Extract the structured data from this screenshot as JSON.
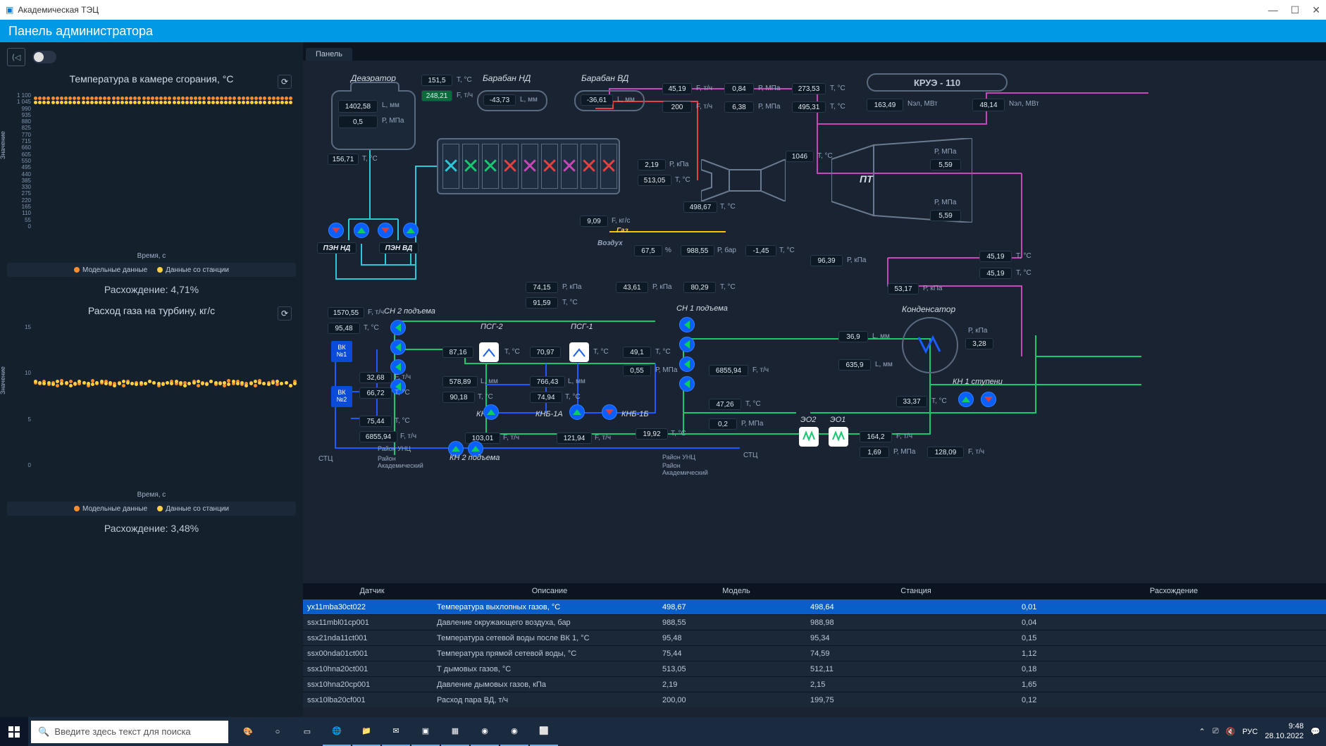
{
  "window": {
    "title": "Академическая ТЭЦ"
  },
  "header": {
    "title": "Панель администратора"
  },
  "rp": {
    "tab": "Панель"
  },
  "chart1": {
    "title": "Температура в камере сгорания, °C",
    "ylabel": "Значение",
    "xlabel": "Время, с",
    "yTicks": [
      "1 100",
      "1 045",
      "990",
      "935",
      "880",
      "825",
      "770",
      "715",
      "660",
      "605",
      "550",
      "495",
      "440",
      "385",
      "330",
      "275",
      "220",
      "165",
      "110",
      "55",
      "0"
    ],
    "legend1": "Модельные данные",
    "legend2": "Данные со станции",
    "divergence": "Расхождение: 4,71%"
  },
  "chart2": {
    "title": "Расход газа на турбину, кг/с",
    "ylabel": "Значение",
    "xlabel": "Время, с",
    "yTicks": [
      "15",
      "10",
      "5",
      "0"
    ],
    "legend1": "Модельные данные",
    "legend2": "Данные со станции",
    "divergence": "Расхождение: 3,48%"
  },
  "mimic": {
    "deaerator": {
      "label": "Деаэратор",
      "L": "1402,58",
      "Lunit": "L, мм",
      "P": "0,5",
      "Punit": "Р, МПа",
      "T1": "151,5",
      "T2": "248,21",
      "T3": "156,71"
    },
    "baraban_nd": {
      "label": "Барабан НД",
      "L": "-43,73",
      "Lunit": "L, мм"
    },
    "baraban_vd": {
      "label": "Барабан ВД",
      "L": "-36,61",
      "Lunit": "L, мм"
    },
    "krue": {
      "label": "КРУЭ - 110",
      "N1": "163,49",
      "N1u": "Nэл, МВт",
      "N2": "48,14",
      "N2u": "Nэл, МВт"
    },
    "row1": {
      "v1": "45,19",
      "u1": "F, т/ч",
      "v2": "0,84",
      "u2": "Р, МПа",
      "v3": "273,53",
      "u3": "T, °C"
    },
    "row2": {
      "v1": "200",
      "u1": "F, т/ч",
      "v2": "6,38",
      "u2": "Р, МПа",
      "v3": "495,31",
      "u3": "T, °C"
    },
    "pen_nd": "ПЭН НД",
    "pen_vd": "ПЭН ВД",
    "gtu": {
      "T": "1046",
      "Tu": "T, °C",
      "Pk": "2,19",
      "Pku": "Р, кПа",
      "Tc": "513,05",
      "Tcu": "T, °C",
      "Te": "498,67",
      "Teu": "T, °C",
      "Fg": "9,09",
      "Fgu": "F, кг/с",
      "gas": "Газ",
      "air": "Воздух",
      "pct": "67,5",
      "pctu": "%",
      "Pb": "988,55",
      "Pbu": "Р, бар",
      "Ta": "-1,45",
      "Tau": "T, °C"
    },
    "pt": {
      "label": "ПТ",
      "P1": "5,59",
      "P1u": "Р, МПа",
      "P2": "5,59",
      "P2u": "Р, МПа"
    },
    "pk1": {
      "v": "96,39",
      "u": "Р, кПа"
    },
    "pk2": {
      "v": "53,17",
      "u": "Р, кПа"
    },
    "tr": {
      "v1": "45,19",
      "v2": "45,19",
      "u": "T, °C"
    },
    "cond": {
      "label": "Конденсатор",
      "L1": "36,9",
      "L2": "635,9",
      "Lu": "L, мм",
      "P": "3,28",
      "Pu": "Р, кПа"
    },
    "kn1s": {
      "label": "КН 1 ступени",
      "T": "33,37",
      "Tu": "T, °C"
    },
    "eo": {
      "e2": "ЭО2",
      "e1": "ЭО1",
      "F": "164,2",
      "Fu": "F, т/ч",
      "P": "1,69",
      "Pu": "Р, МПа",
      "F2": "128,09",
      "F2u": "F, т/ч"
    },
    "psg2": {
      "label": "ПСГ-2",
      "T": "87,16",
      "Tu": "T, °C",
      "L": "578,89",
      "Lu": "L, мм",
      "Td": "90,18",
      "Tdu": "T, °C"
    },
    "psg1": {
      "label": "ПСГ-1",
      "T": "70,97",
      "Tu": "T, °C",
      "L": "766,43",
      "Lu": "L, мм",
      "Td": "74,94",
      "Tdu": "T, °C"
    },
    "cn2": {
      "label": "СН 2 подъема",
      "F": "1570,55",
      "Fu": "F, т/ч",
      "T": "95,48",
      "Tu": "T, °C"
    },
    "cn1": {
      "label": "СН 1 подъема",
      "T": "49,1",
      "Tu": "T, °C",
      "P": "0,55",
      "Pu": "Р, МПа",
      "F": "6855,94",
      "Fu": "F, т/ч",
      "T2": "47,26",
      "T2u": "T, °C",
      "P2": "0,2",
      "P2u": "Р, МПа"
    },
    "vk1": {
      "label": "ВК\n№1",
      "F": "32,68",
      "Fu": "F, т/ч",
      "T": "66,72",
      "Tu": "T, °C"
    },
    "vk2": {
      "label": "ВК\n№2",
      "T": "75,44",
      "Tu": "T, °C",
      "F": "6855,94",
      "Fu": "F, т/ч"
    },
    "knb2": "КНБ-2",
    "knb1a": "КНБ-1А",
    "knb1b": "КНБ-1Б",
    "kn2p": "КН 2 подъема",
    "knb2F": {
      "v": "103,01",
      "u": "F, т/ч"
    },
    "knb1F": {
      "v": "121,94",
      "u": "F, т/ч"
    },
    "knbT": {
      "v": "19,92",
      "u": "T, °C"
    },
    "pk_mid": {
      "P": "74,15",
      "Pu": "Р, кПа",
      "T": "91,59",
      "Tu": "T, °C",
      "P2": "43,61",
      "P2u": "Р, кПа",
      "T2": "80,29",
      "T2u": "T, °C"
    },
    "stc": "СТЦ",
    "runc": "Район УНЦ",
    "rakad": "Район\nАкадемический"
  },
  "table": {
    "headers": [
      "Датчик",
      "Описание",
      "Модель",
      "Станция",
      "Расхождение"
    ],
    "rows": [
      {
        "c1": "yx11mba30ct022",
        "c2": "Температура выхлопных газов, °C",
        "c3": "498,67",
        "c4": "498,64",
        "c5": "0,01"
      },
      {
        "c1": "ssx11mbl01cp001",
        "c2": "Давление окружающего воздуха, бар",
        "c3": "988,55",
        "c4": "988,98",
        "c5": "0,04"
      },
      {
        "c1": "ssx21nda11ct001",
        "c2": "Температура сетевой воды после ВК 1, °C",
        "c3": "95,48",
        "c4": "95,34",
        "c5": "0,15"
      },
      {
        "c1": "ssx00nda01ct001",
        "c2": "Температура прямой сетевой воды, °C",
        "c3": "75,44",
        "c4": "74,59",
        "c5": "1,12"
      },
      {
        "c1": "ssx10hna20ct001",
        "c2": "Т дымовых газов, °C",
        "c3": "513,05",
        "c4": "512,11",
        "c5": "0,18"
      },
      {
        "c1": "ssx10hna20cp001",
        "c2": "Давление дымовых газов, кПа",
        "c3": "2,19",
        "c4": "2,15",
        "c5": "1,65"
      },
      {
        "c1": "ssx10lba20cf001",
        "c2": "Расход пара ВД, т/ч",
        "c3": "200,00",
        "c4": "199,75",
        "c5": "0,12"
      }
    ]
  },
  "taskbar": {
    "search": "Введите здесь текст для поиска",
    "lang": "РУС",
    "time": "9:48",
    "date": "28.10.2022"
  },
  "chart_data": [
    {
      "type": "scatter",
      "title": "Температура в камере сгорания, °C",
      "xlabel": "Время, с",
      "ylabel": "Значение",
      "ylim": [
        0,
        1100
      ],
      "series": [
        {
          "name": "Модельные данные",
          "values": [
            1045,
            1045,
            1045,
            1045,
            1045,
            1045,
            1045,
            1045,
            1045,
            1045,
            1045,
            1045,
            1045,
            1045,
            1045,
            1045,
            1045,
            1045,
            1045,
            1045,
            1045,
            1045,
            1045,
            1045,
            1045,
            1045,
            1045,
            1045,
            1045,
            1045,
            1045,
            1045,
            1045,
            1045,
            1045,
            1045,
            1045,
            1045,
            1045,
            1045,
            1045,
            1045,
            1045,
            1045,
            1045,
            1045,
            1045,
            1045,
            1045,
            1045,
            1045,
            1045,
            1045,
            1045,
            1045,
            1045,
            1045,
            1045,
            1045,
            1045
          ]
        },
        {
          "name": "Данные со станции",
          "values": [
            1060,
            1060,
            1060,
            1060,
            1060,
            1060,
            1060,
            1060,
            1060,
            1060,
            1060,
            1060,
            1060,
            1060,
            1060,
            1060,
            1060,
            1060,
            1060,
            1060,
            1060,
            1060,
            1060,
            1060,
            1060,
            1060,
            1060,
            1060,
            1060,
            1060,
            1060,
            1060,
            1060,
            1060,
            1060,
            1060,
            1060,
            1060,
            1060,
            1060,
            1060,
            1060,
            1060,
            1060,
            1060,
            1060,
            1060,
            1060,
            1060,
            1060,
            1060,
            1060,
            1060,
            1060,
            1060,
            1060,
            1060,
            1060,
            1060,
            1060
          ]
        }
      ]
    },
    {
      "type": "scatter",
      "title": "Расход газа на турбину, кг/с",
      "xlabel": "Время, с",
      "ylabel": "Значение",
      "ylim": [
        0,
        15
      ],
      "series": [
        {
          "name": "Модельные данные",
          "values": [
            9.1,
            9.0,
            9.2,
            8.9,
            9.1,
            8.8,
            9.3,
            9.0,
            9.2,
            8.9,
            9.0,
            9.1,
            8.8,
            9.3,
            9.0,
            9.1,
            9.2,
            8.9,
            9.0,
            9.1,
            8.8,
            9.2,
            9.0,
            9.1,
            8.9,
            9.0,
            9.2,
            9.1,
            8.8,
            9.0,
            9.1,
            9.2,
            9.0,
            8.9,
            9.1,
            9.0,
            9.2,
            8.8,
            9.1,
            9.0,
            9.2,
            8.9,
            9.1,
            8.8,
            9.3,
            9.0,
            9.2,
            8.9,
            9.0,
            9.1,
            8.8,
            9.3,
            9.0,
            9.1,
            9.2,
            8.9,
            9.0,
            9.1,
            8.8,
            9.2
          ]
        },
        {
          "name": "Данные со станции",
          "values": [
            9.2,
            9.1,
            9.0,
            9.1,
            8.9,
            9.2,
            9.0,
            9.1,
            8.8,
            9.0,
            9.2,
            9.1,
            9.0,
            8.9,
            9.1,
            9.2,
            9.0,
            9.1,
            8.8,
            9.0,
            9.2,
            9.1,
            9.0,
            8.9,
            9.1,
            9.0,
            9.2,
            9.1,
            9.0,
            8.9,
            9.1,
            9.0,
            9.2,
            9.1,
            8.8,
            9.0,
            9.1,
            9.2,
            9.0,
            8.9,
            9.2,
            9.1,
            9.0,
            9.1,
            8.9,
            9.2,
            9.0,
            9.1,
            8.8,
            9.0,
            9.2,
            9.1,
            9.0,
            8.9,
            9.1,
            9.2,
            9.0,
            9.1,
            8.8,
            9.0
          ]
        }
      ]
    }
  ]
}
